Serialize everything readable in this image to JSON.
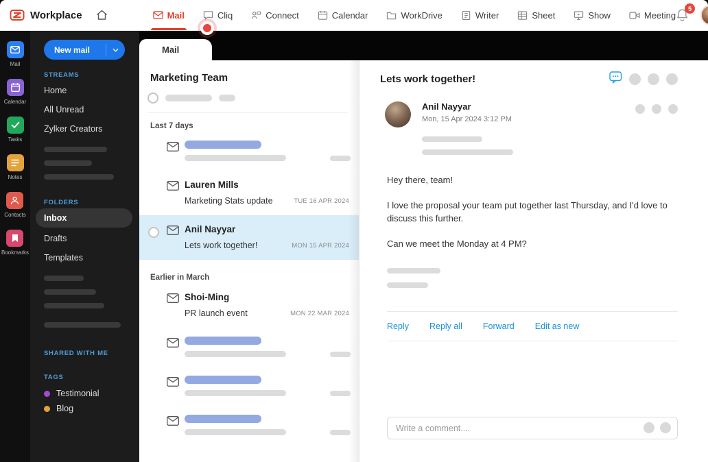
{
  "topbar": {
    "brand": "Workplace",
    "nav": [
      {
        "label": "Mail"
      },
      {
        "label": "Cliq"
      },
      {
        "label": "Connect"
      },
      {
        "label": "Calendar"
      },
      {
        "label": "WorkDrive"
      },
      {
        "label": "Writer"
      },
      {
        "label": "Sheet"
      },
      {
        "label": "Show"
      },
      {
        "label": "Meeting"
      }
    ],
    "active_nav": "Mail",
    "notification_count": "5"
  },
  "app_rail": [
    {
      "label": "Mail"
    },
    {
      "label": "Calendar"
    },
    {
      "label": "Tasks"
    },
    {
      "label": "Notes"
    },
    {
      "label": "Contacts"
    },
    {
      "label": "Bookmarks"
    }
  ],
  "sidebar": {
    "new_mail_label": "New mail",
    "streams_label": "STREAMS",
    "streams": [
      "Home",
      "All Unread",
      "Zylker Creators"
    ],
    "folders_label": "FOLDERS",
    "folders": [
      "Inbox",
      "Drafts",
      "Templates"
    ],
    "active_folder": "Inbox",
    "shared_label": "SHARED WITH ME",
    "tags_label": "TAGS",
    "tags": [
      {
        "label": "Testimonial",
        "color": "#a24bcf"
      },
      {
        "label": "Blog",
        "color": "#e2a33c"
      }
    ]
  },
  "tab": {
    "label": "Mail"
  },
  "mail_list": {
    "title": "Marketing Team",
    "group1": "Last 7 days",
    "group2": "Earlier in March",
    "items": [
      {
        "sender": "Lauren Mills",
        "subject": "Marketing Stats update",
        "date": "TUE 16 APR 2024"
      },
      {
        "sender": "Anil Nayyar",
        "subject": "Lets work together!",
        "date": "MON 15 APR 2024",
        "selected": true
      },
      {
        "sender": "Shoi-Ming",
        "subject": "PR launch event",
        "date": "MON 22 MAR 2024"
      }
    ]
  },
  "reader": {
    "subject": "Lets work together!",
    "sender": "Anil Nayyar",
    "datetime": "Mon, 15 Apr 2024  3:12 PM",
    "body": [
      "Hey there, team!",
      "I love the proposal your team put together last Thursday, and I'd love to discuss this further.",
      "Can we meet the Monday at 4 PM?"
    ],
    "actions": [
      "Reply",
      "Reply all",
      "Forward",
      "Edit as new"
    ],
    "comment_placeholder": "Write a comment...."
  },
  "colors": {
    "accent_red": "#e0402a",
    "link_blue": "#1791d8",
    "new_mail_blue": "#1e78eb",
    "selected_row_bg": "#d9eef9",
    "section_label_blue": "#4f9cd8"
  }
}
